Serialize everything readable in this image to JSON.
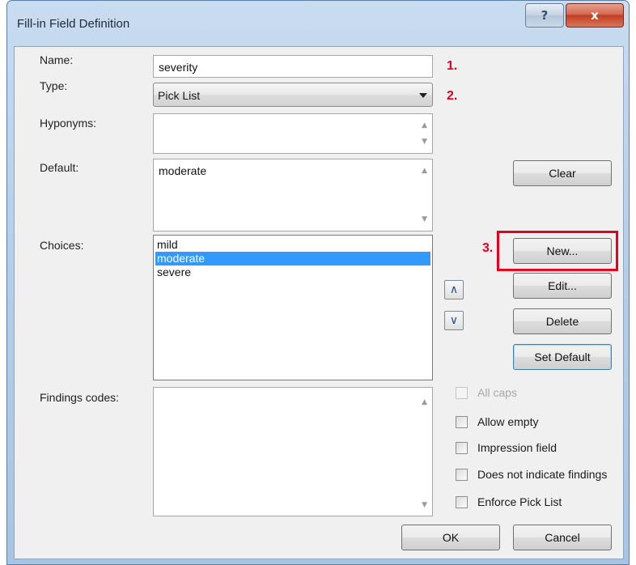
{
  "window": {
    "title": "Fill-in Field Definition",
    "help_glyph": "?",
    "close_glyph": "x"
  },
  "labels": {
    "name": "Name:",
    "type": "Type:",
    "hyponyms": "Hyponyms:",
    "default": "Default:",
    "choices": "Choices:",
    "findings_codes": "Findings codes:"
  },
  "fields": {
    "name_value": "severity",
    "type_value": "Pick List",
    "hyponyms_value": "",
    "default_value": "moderate",
    "findings_codes_value": ""
  },
  "choices": {
    "items": [
      "mild",
      "moderate",
      "severe"
    ],
    "selected": "moderate"
  },
  "steps": {
    "step1": "1.",
    "step2": "2.",
    "step3": "3."
  },
  "buttons": {
    "clear": "Clear",
    "new": "New...",
    "edit": "Edit...",
    "delete": "Delete",
    "set_default": "Set Default",
    "move_up": "∧",
    "move_down": "∨",
    "ok": "OK",
    "cancel": "Cancel"
  },
  "checkboxes": [
    {
      "label": "All caps",
      "checked": false,
      "enabled": false
    },
    {
      "label": "Allow empty",
      "checked": false,
      "enabled": true
    },
    {
      "label": "Impression field",
      "checked": false,
      "enabled": true
    },
    {
      "label": "Does not indicate findings",
      "checked": false,
      "enabled": true
    },
    {
      "label": "Enforce Pick List",
      "checked": false,
      "enabled": true
    }
  ],
  "scroll_glyphs": {
    "up": "▲",
    "down": "▼"
  },
  "colors": {
    "accent_red": "#e8001c",
    "selection_blue": "#3399ff"
  }
}
